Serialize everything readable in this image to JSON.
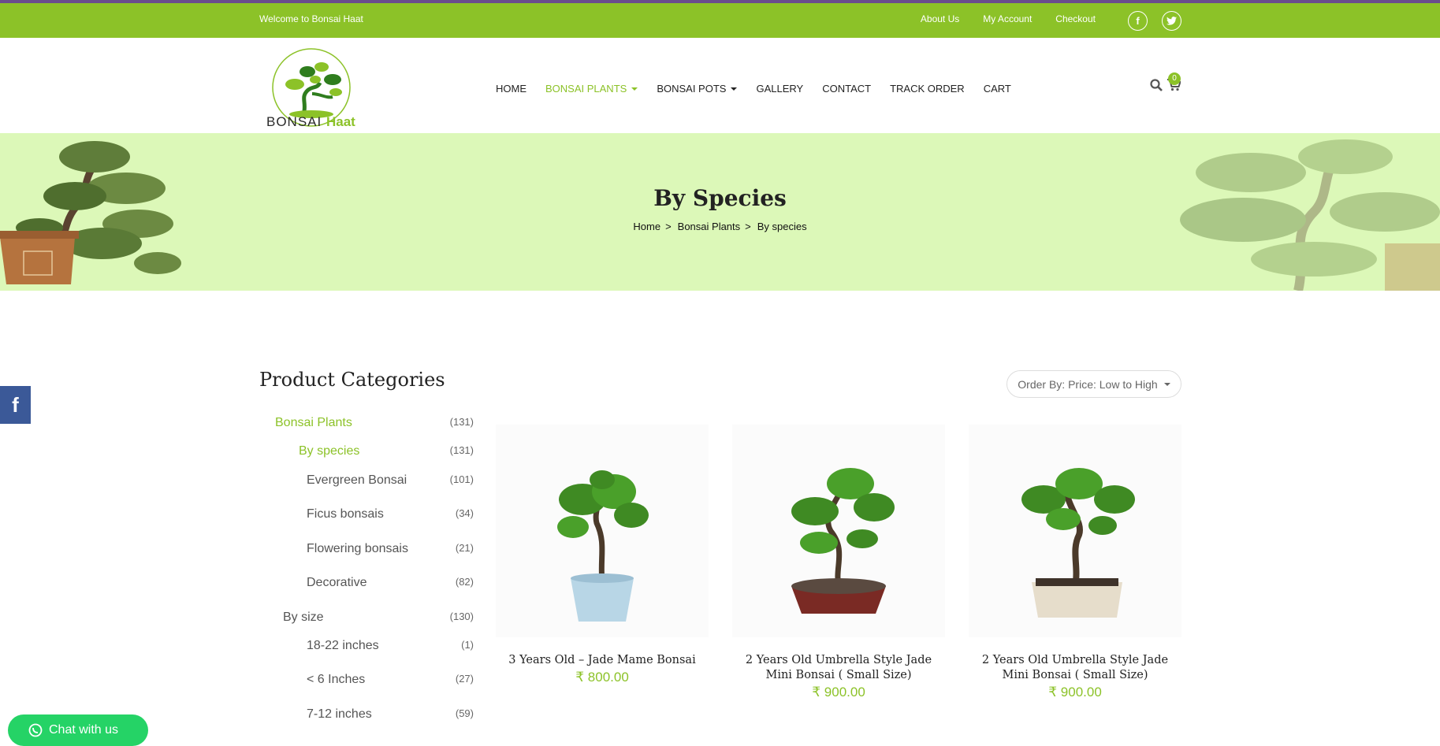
{
  "topbar": {
    "welcome": "Welcome to Bonsai Haat",
    "links": [
      "About Us",
      "My Account",
      "Checkout"
    ],
    "social": [
      {
        "icon": "facebook-icon",
        "glyph": "f"
      },
      {
        "icon": "twitter-icon",
        "glyph": "t"
      }
    ]
  },
  "logo": {
    "text_main": "BONSAI",
    "text_accent": "Haat"
  },
  "nav": {
    "items": [
      {
        "label": "HOME",
        "active": false,
        "dropdown": false
      },
      {
        "label": "BONSAI PLANTS",
        "active": true,
        "dropdown": true
      },
      {
        "label": "BONSAI POTS",
        "active": false,
        "dropdown": true
      },
      {
        "label": "GALLERY",
        "active": false,
        "dropdown": false
      },
      {
        "label": "CONTACT",
        "active": false,
        "dropdown": false
      },
      {
        "label": "TRACK ORDER",
        "active": false,
        "dropdown": false
      },
      {
        "label": "CART",
        "active": false,
        "dropdown": false
      }
    ],
    "cart_count": "0"
  },
  "banner": {
    "title": "By Species",
    "breadcrumb": [
      "Home",
      "Bonsai Plants",
      "By species"
    ],
    "separator": ">"
  },
  "sidebar": {
    "title": "Product Categories",
    "categories": [
      {
        "label": "Bonsai Plants",
        "count": "(131)"
      },
      {
        "label": "By species",
        "count": "(131)"
      },
      {
        "label": "Evergreen Bonsai",
        "count": "(101)"
      },
      {
        "label": "Ficus bonsais",
        "count": "(34)"
      },
      {
        "label": "Flowering bonsais",
        "count": "(21)"
      },
      {
        "label": "Decorative",
        "count": "(82)"
      },
      {
        "label": "By size",
        "count": "(130)"
      },
      {
        "label": "18-22 inches",
        "count": "(1)"
      },
      {
        "label": "< 6 Inches",
        "count": "(27)"
      },
      {
        "label": "7-12 inches",
        "count": "(59)"
      }
    ]
  },
  "orderby": {
    "label": "Order By: Price: Low to High"
  },
  "products": [
    {
      "name": "3 Years Old – Jade Mame Bonsai",
      "price": "800.00",
      "currency": "₹",
      "pot_color": "#b8d6e6"
    },
    {
      "name": "2 Years Old Umbrella Style Jade Mini Bonsai ( Small Size)",
      "price": "900.00",
      "currency": "₹",
      "pot_color": "#7a2a24"
    },
    {
      "name": "2 Years Old Umbrella Style Jade Mini Bonsai ( Small Size)",
      "price": "900.00",
      "currency": "₹",
      "pot_color": "#e6ddcb"
    }
  ],
  "floating": {
    "facebook": "f",
    "chat": "Chat with us"
  },
  "colors": {
    "brand_green": "#8cc228",
    "banner_bg": "#dcf8b8",
    "top_border": "#6a4d8e"
  }
}
